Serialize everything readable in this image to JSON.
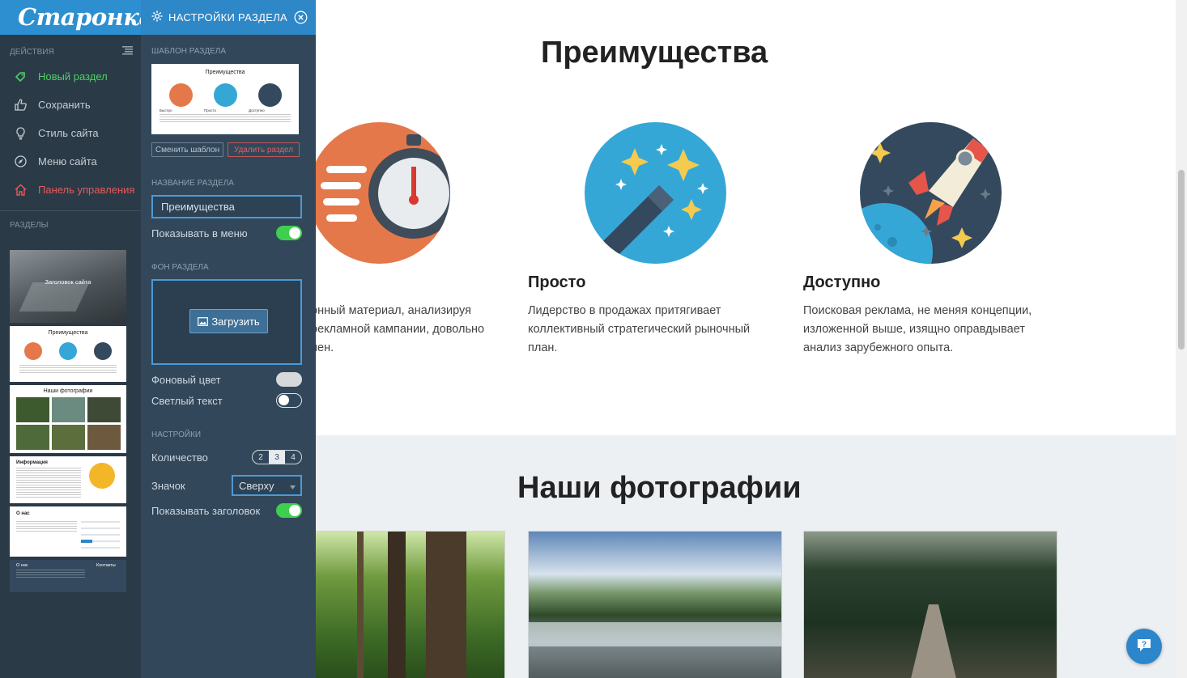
{
  "sidebar": {
    "logo": "Старонка",
    "actions_header": "ДЕЙСТВИЯ",
    "actions": [
      {
        "label": "Новый раздел",
        "icon": "new-section-icon",
        "color": "#4cd264"
      },
      {
        "label": "Сохранить",
        "icon": "thumbs-up-icon"
      },
      {
        "label": "Стиль сайта",
        "icon": "lightbulb-icon"
      },
      {
        "label": "Меню сайта",
        "icon": "compass-icon"
      },
      {
        "label": "Панель управления",
        "icon": "home-icon",
        "color": "#e35b5b"
      }
    ],
    "sections_header": "РАЗДЕЛЫ",
    "thumbs": [
      {
        "label": "Заголовок сайта"
      },
      {
        "label": "Преимущества"
      },
      {
        "label": "Наши фотографии"
      },
      {
        "label": "Информация"
      },
      {
        "label": "О нас"
      },
      {
        "label": "О нас",
        "label2": "Контакты"
      }
    ]
  },
  "panel": {
    "title": "НАСТРОЙКИ РАЗДЕЛА",
    "template_label": "ШАБЛОН РАЗДЕЛА",
    "template_preview_title": "Преимущества",
    "template_preview_items": [
      "Быстро",
      "Просто",
      "Доступно"
    ],
    "change_template": "Сменить шаблон",
    "delete_section": "Удалить раздел",
    "name_label": "НАЗВАНИЕ РАЗДЕЛА",
    "name_value": "Преимущества",
    "show_in_menu": "Показывать в меню",
    "show_in_menu_on": true,
    "bg_label": "ФОН РАЗДЕЛА",
    "upload": "Загрузить",
    "bg_color": "Фоновый цвет",
    "light_text": "Светлый текст",
    "settings_label": "НАСТРОЙКИ",
    "count_label": "Количество",
    "count_options": [
      "2",
      "3",
      "4"
    ],
    "count_selected": "3",
    "icon_label": "Значок",
    "icon_value": "Сверху",
    "show_title": "Показывать заголовок",
    "show_title_on": true
  },
  "content": {
    "section1_title": "Преимущества",
    "features": [
      {
        "title": "",
        "text": [
          "онный материал, анализируя",
          "рекламной кампании, довольно",
          "нен."
        ]
      },
      {
        "title": "Просто",
        "text": [
          "Лидерство в продажах притягивает",
          "коллективный стратегический рыночный",
          "план."
        ]
      },
      {
        "title": "Доступно",
        "text": [
          "Поисковая реклама, не меняя концепции,",
          "изложенной выше, изящно оправдывает",
          "анализ зарубежного опыта."
        ]
      }
    ],
    "section2_title": "Наши фотографии"
  },
  "colors": {
    "accent": "#2e87c7",
    "sidebar_bg": "#2b3a47",
    "panel_bg": "#32475a",
    "toggle_on": "#3ecf4e"
  }
}
